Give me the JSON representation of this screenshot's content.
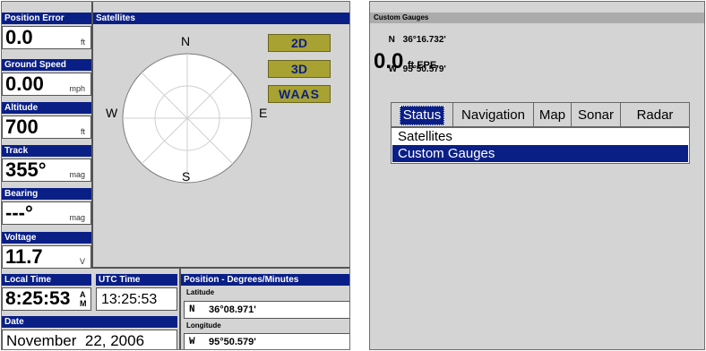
{
  "left": {
    "position_error": {
      "label": "Position Error",
      "value": "0.0",
      "unit": "ft"
    },
    "ground_speed": {
      "label": "Ground Speed",
      "value": "0.00",
      "unit": "mph"
    },
    "altitude": {
      "label": "Altitude",
      "value": "700",
      "unit": "ft"
    },
    "track": {
      "label": "Track",
      "value": "355°",
      "unit": "mag"
    },
    "bearing": {
      "label": "Bearing",
      "value": "---°",
      "unit": "mag"
    },
    "voltage": {
      "label": "Voltage",
      "value": "11.7",
      "unit": "V"
    },
    "satellites": {
      "label": "Satellites",
      "north": "N",
      "south": "S",
      "east": "E",
      "west": "W",
      "modes": [
        "2D",
        "3D",
        "WAAS"
      ]
    },
    "local_time": {
      "label": "Local Time",
      "value": "8:25:53",
      "ampm_top": "A",
      "ampm_bottom": "M"
    },
    "utc_time": {
      "label": "UTC Time",
      "value": "13:25:53"
    },
    "date": {
      "label": "Date",
      "value": "November  22, 2006"
    },
    "position": {
      "label": "Position - Degrees/Minutes",
      "latitude_label": "Latitude",
      "latitude_hemi": "N",
      "latitude_value": "36°08.971'",
      "longitude_label": "Longitude",
      "longitude_hemi": "W",
      "longitude_value": "95°50.579'"
    }
  },
  "right": {
    "title": "Custom Gauges",
    "lat_hemi": "N",
    "lat_value": "36°16.732'",
    "lon_hemi": "W",
    "lon_value": "95°50.579'",
    "epe_value": "0.0",
    "epe_unit": "ft EPE",
    "tabs": [
      "Status",
      "Navigation",
      "Map",
      "Sonar",
      "Radar"
    ],
    "selected_tab": "Status",
    "menu_items": [
      "Satellites",
      "Custom Gauges"
    ],
    "selected_menu_item": "Custom Gauges"
  },
  "colors": {
    "header_blue": "#0a1f86",
    "screen_gray": "#d4d4d4",
    "mode_button_olive": "#a7a232"
  }
}
